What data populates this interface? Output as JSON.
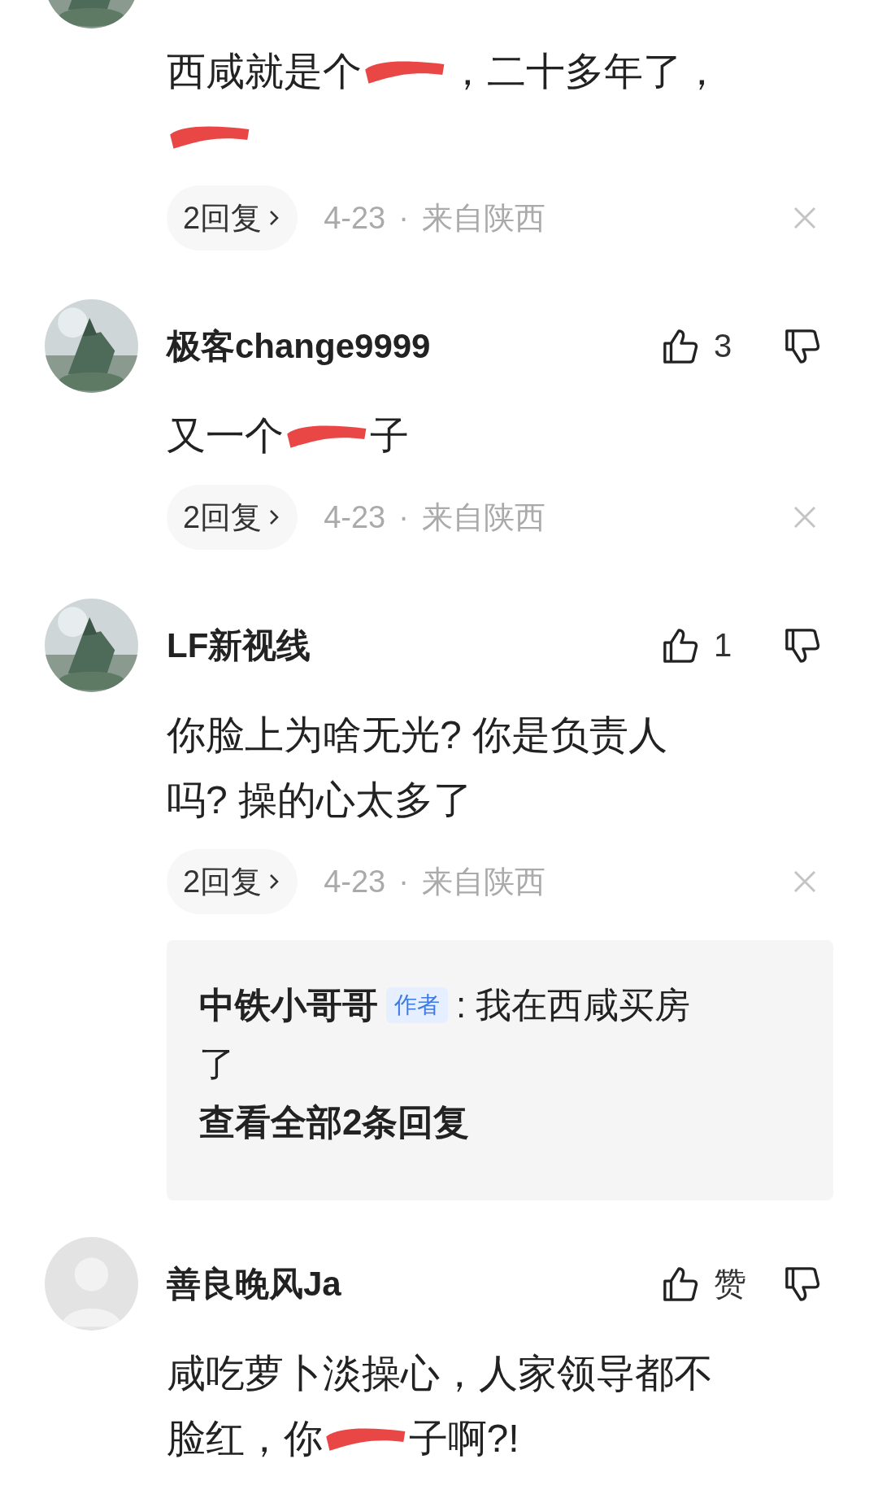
{
  "comments": [
    {
      "avatar": {
        "kind": "picture"
      },
      "body": [
        {
          "kind": "text",
          "text": "西咸就是个"
        },
        {
          "kind": "redacted"
        },
        {
          "kind": "text",
          "text": "，二十多年了，"
        },
        {
          "kind": "redacted"
        }
      ],
      "replies_button": "2回复",
      "date": "4-23",
      "separator": "·",
      "location": "来自陕西"
    },
    {
      "avatar": {
        "kind": "picture"
      },
      "name": "极客change9999",
      "likes": "3",
      "body": [
        {
          "kind": "text",
          "text": "又一个"
        },
        {
          "kind": "redacted"
        },
        {
          "kind": "text",
          "text": "子"
        }
      ],
      "replies_button": "2回复",
      "date": "4-23",
      "separator": "·",
      "location": "来自陕西"
    },
    {
      "avatar": {
        "kind": "picture"
      },
      "name": "LF新视线",
      "likes": "1",
      "body": [
        {
          "kind": "text",
          "text": "你脸上为啥无光? 你是负责人"
        },
        {
          "kind": "text",
          "text": "吗? 操的心太多了"
        }
      ],
      "replies_button": "2回复",
      "date": "4-23",
      "separator": "·",
      "location": "来自陕西",
      "reply_preview": {
        "author": "中铁小哥哥",
        "badge": "作者",
        "text": [
          ": 我在西咸买房",
          "了"
        ],
        "link": "查看全部2条回复"
      }
    },
    {
      "avatar": {
        "kind": "silhouette"
      },
      "name": "善良晚风Ja",
      "likes": "赞",
      "body": [
        {
          "kind": "text",
          "text": "咸吃萝卜淡操心，人家领导都不"
        },
        {
          "kind": "text",
          "text": "脸红，你"
        },
        {
          "kind": "redacted"
        },
        {
          "kind": "text",
          "text": "子啊?!"
        }
      ]
    }
  ]
}
